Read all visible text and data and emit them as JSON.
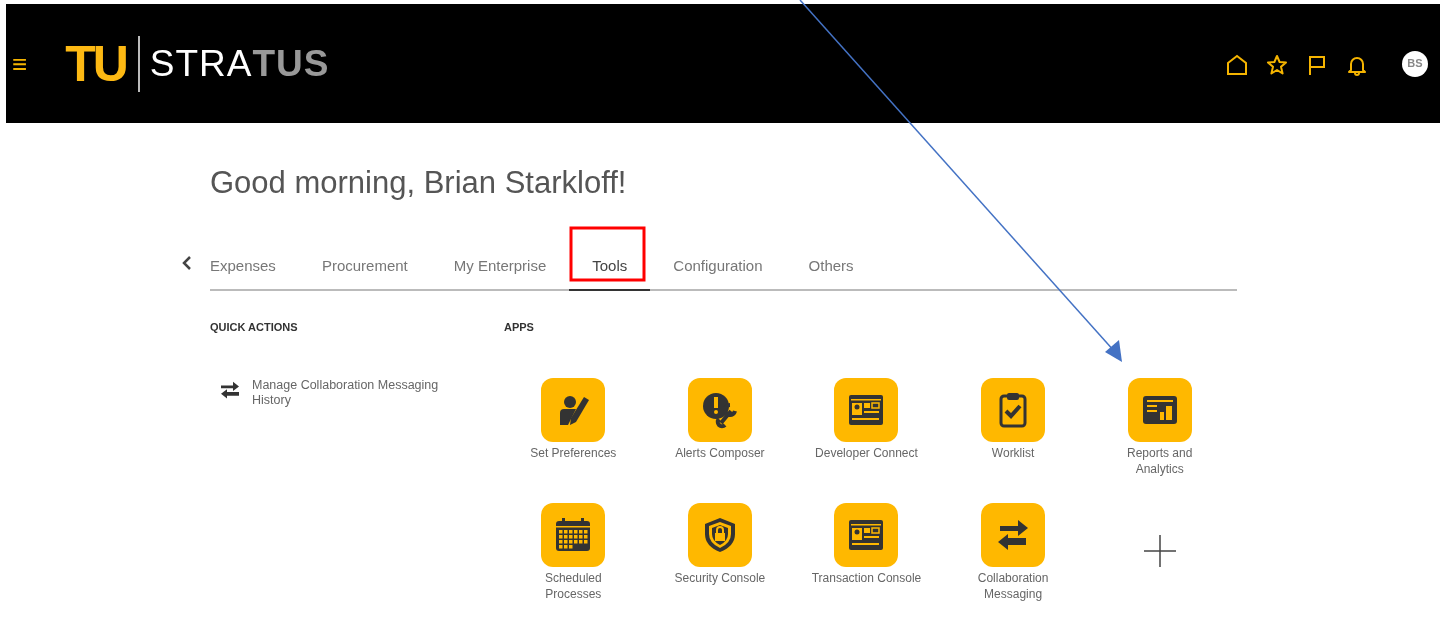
{
  "header": {
    "menu_glyph": "≡",
    "logo": {
      "mark": "TU",
      "word_light": "STRA",
      "word_dark": "TUS"
    },
    "avatar": "BS"
  },
  "greeting": "Good morning, Brian Starkloff!",
  "tabs": [
    {
      "label": "Expenses",
      "selected": false
    },
    {
      "label": "Procurement",
      "selected": false
    },
    {
      "label": "My Enterprise",
      "selected": false
    },
    {
      "label": "Tools",
      "selected": true
    },
    {
      "label": "Configuration",
      "selected": false
    },
    {
      "label": "Others",
      "selected": false
    }
  ],
  "quick_actions": {
    "heading": "QUICK ACTIONS",
    "items": [
      {
        "label": "Manage Collaboration Messaging History"
      }
    ]
  },
  "apps": {
    "heading": "APPS",
    "items": [
      {
        "kind": "app",
        "label": "Set Preferences"
      },
      {
        "kind": "app",
        "label": "Alerts Composer"
      },
      {
        "kind": "app",
        "label": "Developer Connect"
      },
      {
        "kind": "app",
        "label": "Worklist"
      },
      {
        "kind": "app",
        "label": "Reports and Analytics"
      },
      {
        "kind": "app",
        "label": "Scheduled Processes"
      },
      {
        "kind": "app",
        "label": "Security Console"
      },
      {
        "kind": "app",
        "label": "Transaction Console"
      },
      {
        "kind": "app",
        "label": "Collaboration Messaging"
      },
      {
        "kind": "add"
      }
    ]
  },
  "annotations": [
    {
      "kind": "box",
      "color": "#ff0000"
    },
    {
      "kind": "arrow",
      "color": "#4472c4"
    }
  ]
}
